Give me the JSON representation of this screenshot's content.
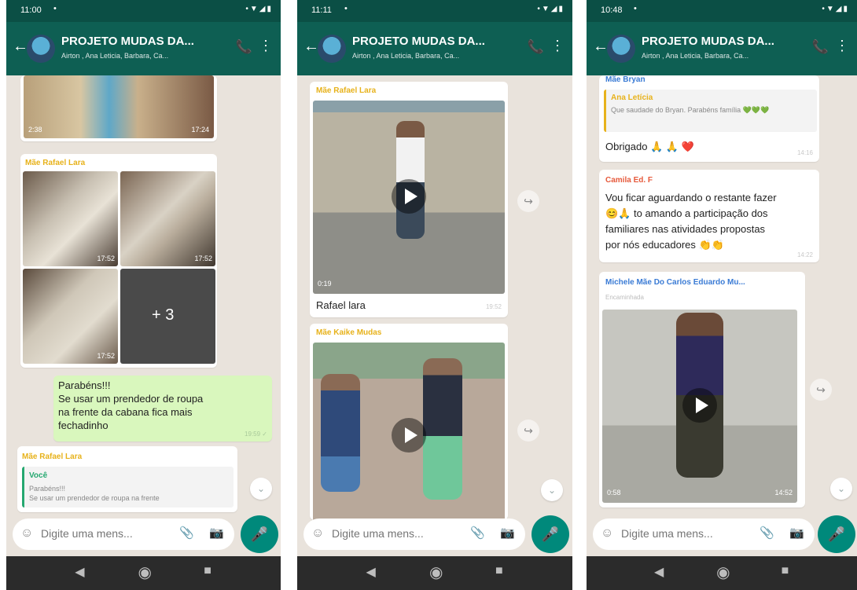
{
  "phones": [
    {
      "status_time": "11:00",
      "header": {
        "title": "PROJETO MUDAS DA...",
        "subtitle": "Airton , Ana Leticia, Barbara, Ca..."
      },
      "top_video": {
        "duration": "2:38",
        "time": "17:24"
      },
      "album": {
        "sender": "Mãe Rafael Lara",
        "time1": "17:52",
        "time2": "17:52",
        "time3": "17:52",
        "more": "+ 3"
      },
      "out_msg": {
        "lines": [
          "Parabéns!!!",
          "Se usar um prendedor de roupa",
          "na frente da cabana fica mais",
          "fechadinho"
        ],
        "time": "19:59 ✓"
      },
      "reply": {
        "sender": "Mãe Rafael Lara",
        "quote_name": "Você",
        "quote_lines": [
          "Parabéns!!!",
          "Se usar um prendedor de roupa na frente"
        ]
      },
      "input_placeholder": "Digite uma mens..."
    },
    {
      "status_time": "11:11",
      "header": {
        "title": "PROJETO MUDAS DA...",
        "subtitle": "Airton , Ana Leticia, Barbara, Ca..."
      },
      "video1": {
        "sender": "Mãe Rafael Lara",
        "duration": "0:19",
        "caption": "Rafael lara",
        "time": "19:52"
      },
      "video2": {
        "sender": "Mãe Kaike Mudas"
      },
      "input_placeholder": "Digite uma mens..."
    },
    {
      "status_time": "10:48",
      "header": {
        "title": "PROJETO MUDAS DA...",
        "subtitle": "Airton , Ana Leticia, Barbara, Ca..."
      },
      "msg1": {
        "sender": "Mãe Bryan",
        "quote_name": "Ana Letícia",
        "quote_text": "Que saudade do Bryan. Parabéns família 💚💚💚",
        "text": "Obrigado 🙏 🙏 ❤️",
        "time": "14:16"
      },
      "msg2": {
        "sender": "Camila Ed. F",
        "lines": [
          "Vou ficar aguardando o restante fazer",
          "😊🙏 to amando a participação dos",
          "familiares nas atividades propostas",
          "por nós educadores 👏👏"
        ],
        "time": "14:22"
      },
      "msg3": {
        "sender": "Michele  Mãe Do Carlos Eduardo Mu...",
        "forwarded": "Encaminhada",
        "duration": "0:58",
        "time": "14:52"
      },
      "input_placeholder": "Digite uma mens..."
    }
  ],
  "icons": {
    "back": "←",
    "call": "📞",
    "menu": "⋮",
    "emoji": "☺",
    "clip": "📎",
    "camera": "📷",
    "mic": "🎤",
    "share": "↪",
    "scroll": "⌄",
    "nav_back": "◀",
    "nav_home": "◉",
    "nav_recent": "■"
  }
}
